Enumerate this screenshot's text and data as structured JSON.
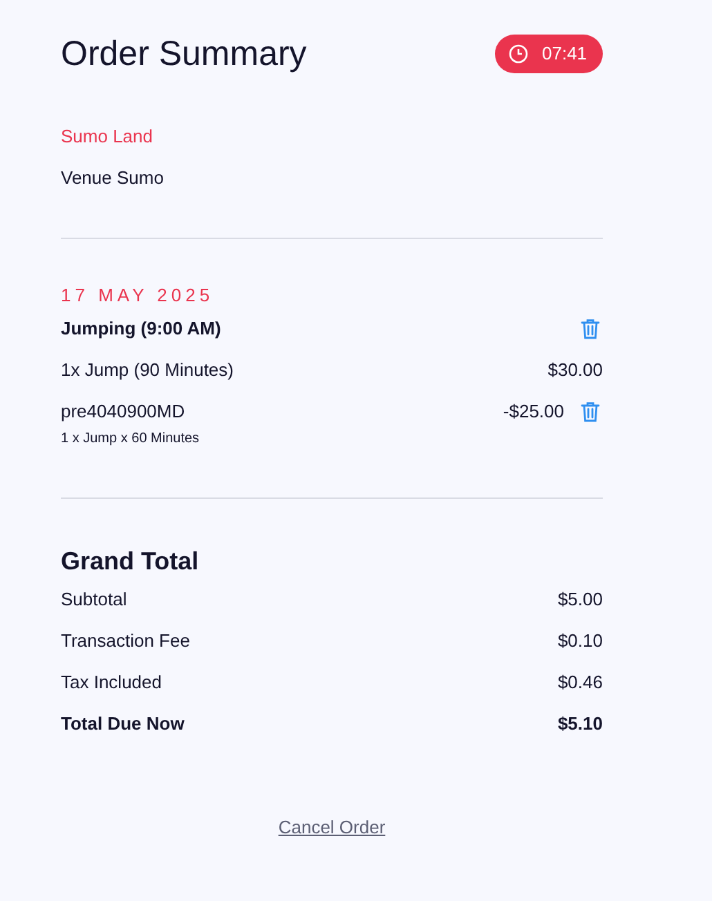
{
  "header": {
    "title": "Order Summary",
    "timer": "07:41"
  },
  "venue": {
    "name": "Sumo Land",
    "subtitle": "Venue Sumo"
  },
  "booking": {
    "date": "17 MAY 2025",
    "rows": [
      {
        "kind": "heading",
        "label": "Jumping (9:00 AM)",
        "removable": true
      },
      {
        "kind": "item",
        "label": "1x Jump (90 Minutes)",
        "amount": "$30.00",
        "removable": false
      },
      {
        "kind": "item",
        "label": "pre4040900MD",
        "amount": "-$25.00",
        "removable": true,
        "note": "1 x Jump x 60 Minutes"
      }
    ]
  },
  "totals": {
    "title": "Grand Total",
    "rows": [
      {
        "kind": "line",
        "label": "Subtotal",
        "amount": "$5.00"
      },
      {
        "kind": "line",
        "label": "Transaction Fee",
        "amount": "$0.10"
      },
      {
        "kind": "line",
        "label": "Tax Included",
        "amount": "$0.46"
      },
      {
        "kind": "total",
        "label": "Total Due Now",
        "amount": "$5.10"
      }
    ]
  },
  "cancel_link": "Cancel Order"
}
